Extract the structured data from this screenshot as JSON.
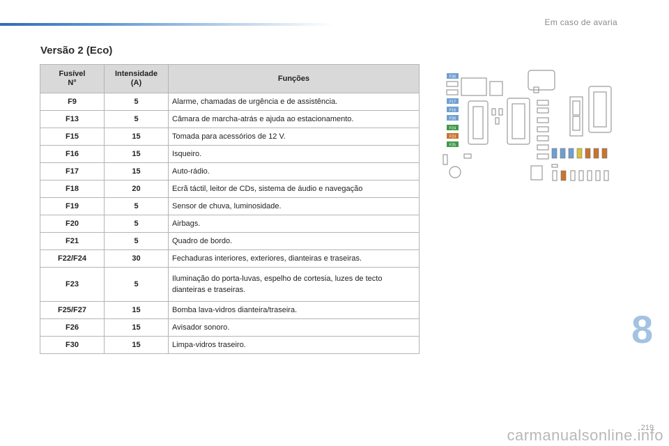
{
  "header": {
    "section_label": "Em caso de avaria"
  },
  "title": "Versão 2 (Eco)",
  "table": {
    "headers": {
      "fuse": "Fusível\nN°",
      "amps": "Intensidade\n(A)",
      "functions": "Funções"
    },
    "rows": [
      {
        "fuse": "F9",
        "amps": "5",
        "function": "Alarme, chamadas de urgência e de assistência."
      },
      {
        "fuse": "F13",
        "amps": "5",
        "function": "Câmara de marcha-atrás e ajuda ao estacionamento."
      },
      {
        "fuse": "F15",
        "amps": "15",
        "function": "Tomada para acessórios de 12 V."
      },
      {
        "fuse": "F16",
        "amps": "15",
        "function": "Isqueiro."
      },
      {
        "fuse": "F17",
        "amps": "15",
        "function": "Auto-rádio."
      },
      {
        "fuse": "F18",
        "amps": "20",
        "function": "Ecrã táctil, leitor de CDs, sistema de áudio e navegação"
      },
      {
        "fuse": "F19",
        "amps": "5",
        "function": "Sensor de chuva, luminosidade."
      },
      {
        "fuse": "F20",
        "amps": "5",
        "function": "Airbags."
      },
      {
        "fuse": "F21",
        "amps": "5",
        "function": "Quadro de bordo."
      },
      {
        "fuse": "F22/F24",
        "amps": "30",
        "function": "Fechaduras interiores, exteriores, dianteiras e traseiras."
      },
      {
        "fuse": "F23",
        "amps": "5",
        "function": "Iluminação do porta-luvas, espelho de cortesia, luzes de tecto\ndianteiras e traseiras."
      },
      {
        "fuse": "F25/F27",
        "amps": "15",
        "function": "Bomba lava-vidros dianteira/traseira."
      },
      {
        "fuse": "F26",
        "amps": "15",
        "function": "Avisador sonoro."
      },
      {
        "fuse": "F30",
        "amps": "15",
        "function": "Limpa-vidros traseiro."
      }
    ]
  },
  "diagram": {
    "fuse_labels": [
      "F30",
      "F17",
      "F16",
      "F26",
      "F24",
      "F23",
      "F25"
    ],
    "colors": {
      "blue": "#6f9fd1",
      "green": "#3f9a4a",
      "orange": "#c8742f",
      "yellow": "#d9c23a",
      "outline": "#9a9a9a"
    }
  },
  "chapter_number": "8",
  "page_number": "219",
  "footer": "carmanualsonline.info"
}
